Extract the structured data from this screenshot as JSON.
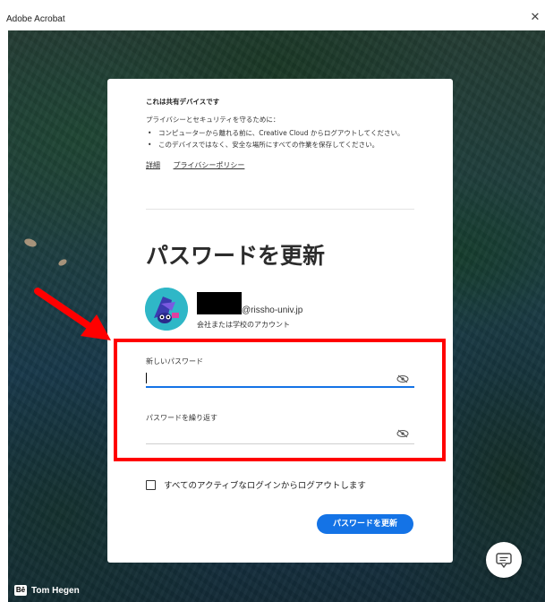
{
  "window": {
    "title": "Adobe Acrobat",
    "close_glyph": "✕"
  },
  "background": {
    "credit_badge": "Bē",
    "credit_name": "Tom Hegen"
  },
  "notice": {
    "heading": "これは共有デバイスです",
    "intro": "プライバシーとセキュリティを守るために：",
    "bullets": [
      "コンピューターから離れる前に、Creative Cloud からログアウトしてください。",
      "このデバイスではなく、安全な場所にすべての作業を保存してください。"
    ],
    "link_details": "詳細",
    "link_privacy": "プライバシーポリシー"
  },
  "form": {
    "title": "パスワードを更新",
    "account_email_domain": "@rissho-univ.jp",
    "account_type": "会社または学校のアカウント",
    "new_password_label": "新しいパスワード",
    "new_password_value": "",
    "repeat_password_label": "パスワードを繰り返す",
    "repeat_password_value": "",
    "logout_checkbox_label": "すべてのアクティブなログインからログアウトします",
    "logout_checkbox_checked": false,
    "submit_label": "パスワードを更新"
  },
  "icons": {
    "eye_hidden": "eye-slash-icon",
    "chat": "chat-icon",
    "avatar": "avatar-illustration"
  },
  "colors": {
    "accent": "#1473e6",
    "annotation_red": "#ff0000",
    "card_bg": "#ffffff"
  }
}
